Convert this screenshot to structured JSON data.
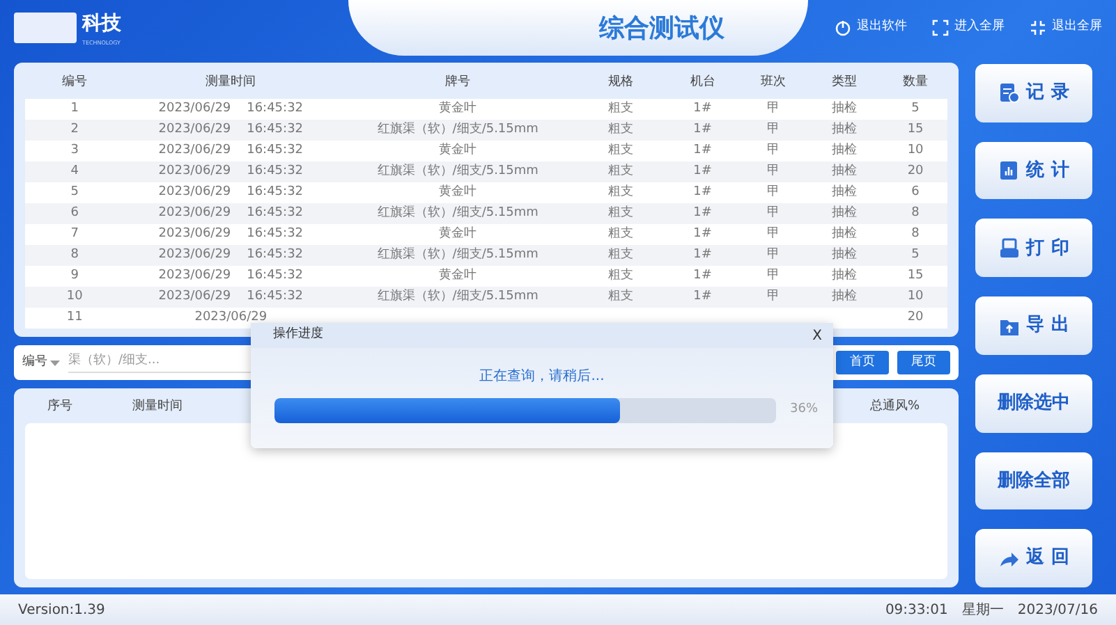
{
  "header": {
    "brand": "科技",
    "brand_sub": "TECHNOLOGY",
    "title": "综合测试仪",
    "actions": [
      {
        "kind": "power",
        "label": "退出软件"
      },
      {
        "kind": "expand",
        "label": "进入全屏"
      },
      {
        "kind": "shrink",
        "label": "退出全屏"
      }
    ]
  },
  "table": {
    "columns": [
      "编号",
      "测量时间",
      "牌号",
      "规格",
      "机台",
      "班次",
      "类型",
      "数量"
    ],
    "rows": [
      [
        "1",
        "2023/06/29    16:45:32",
        "黄金叶",
        "粗支",
        "1#",
        "甲",
        "抽检",
        "5"
      ],
      [
        "2",
        "2023/06/29    16:45:32",
        "红旗渠（软）/细支/5.15mm",
        "粗支",
        "1#",
        "甲",
        "抽检",
        "15"
      ],
      [
        "3",
        "2023/06/29    16:45:32",
        "黄金叶",
        "粗支",
        "1#",
        "甲",
        "抽检",
        "10"
      ],
      [
        "4",
        "2023/06/29    16:45:32",
        "红旗渠（软）/细支/5.15mm",
        "粗支",
        "1#",
        "甲",
        "抽检",
        "20"
      ],
      [
        "5",
        "2023/06/29    16:45:32",
        "黄金叶",
        "粗支",
        "1#",
        "甲",
        "抽检",
        "6"
      ],
      [
        "6",
        "2023/06/29    16:45:32",
        "红旗渠（软）/细支/5.15mm",
        "粗支",
        "1#",
        "甲",
        "抽检",
        "8"
      ],
      [
        "7",
        "2023/06/29    16:45:32",
        "黄金叶",
        "粗支",
        "1#",
        "甲",
        "抽检",
        "8"
      ],
      [
        "8",
        "2023/06/29    16:45:32",
        "红旗渠（软）/细支/5.15mm",
        "粗支",
        "1#",
        "甲",
        "抽检",
        "5"
      ],
      [
        "9",
        "2023/06/29    16:45:32",
        "黄金叶",
        "粗支",
        "1#",
        "甲",
        "抽检",
        "15"
      ],
      [
        "10",
        "2023/06/29    16:45:32",
        "红旗渠（软）/细支/5.15mm",
        "粗支",
        "1#",
        "甲",
        "抽检",
        "10"
      ],
      [
        "11",
        "2023/06/29",
        null,
        null,
        null,
        null,
        null,
        "20"
      ]
    ]
  },
  "filter": {
    "field_select": "编号",
    "value": "渠（软）/细支...",
    "buttons": [
      "首页",
      "尾页"
    ]
  },
  "detail_table": {
    "columns": [
      "序号",
      "测量时间",
      "总通风%"
    ]
  },
  "side_buttons": [
    {
      "kind": "record",
      "label": "记 录"
    },
    {
      "kind": "stats",
      "label": "统 计"
    },
    {
      "kind": "print",
      "label": "打 印"
    },
    {
      "kind": "export",
      "label": "导 出"
    },
    {
      "kind": "none",
      "label": "删除选中"
    },
    {
      "kind": "none",
      "label": "删除全部"
    },
    {
      "kind": "back",
      "label": "返 回"
    }
  ],
  "dialog": {
    "title": "操作进度",
    "close": "X",
    "message": "正在查询，请稍后...",
    "level": 0.69,
    "reading": "36%"
  },
  "status_bar": {
    "version": "Version:1.39",
    "time": "09:33:01",
    "weekday": "星期一",
    "date": "2023/07/16"
  }
}
